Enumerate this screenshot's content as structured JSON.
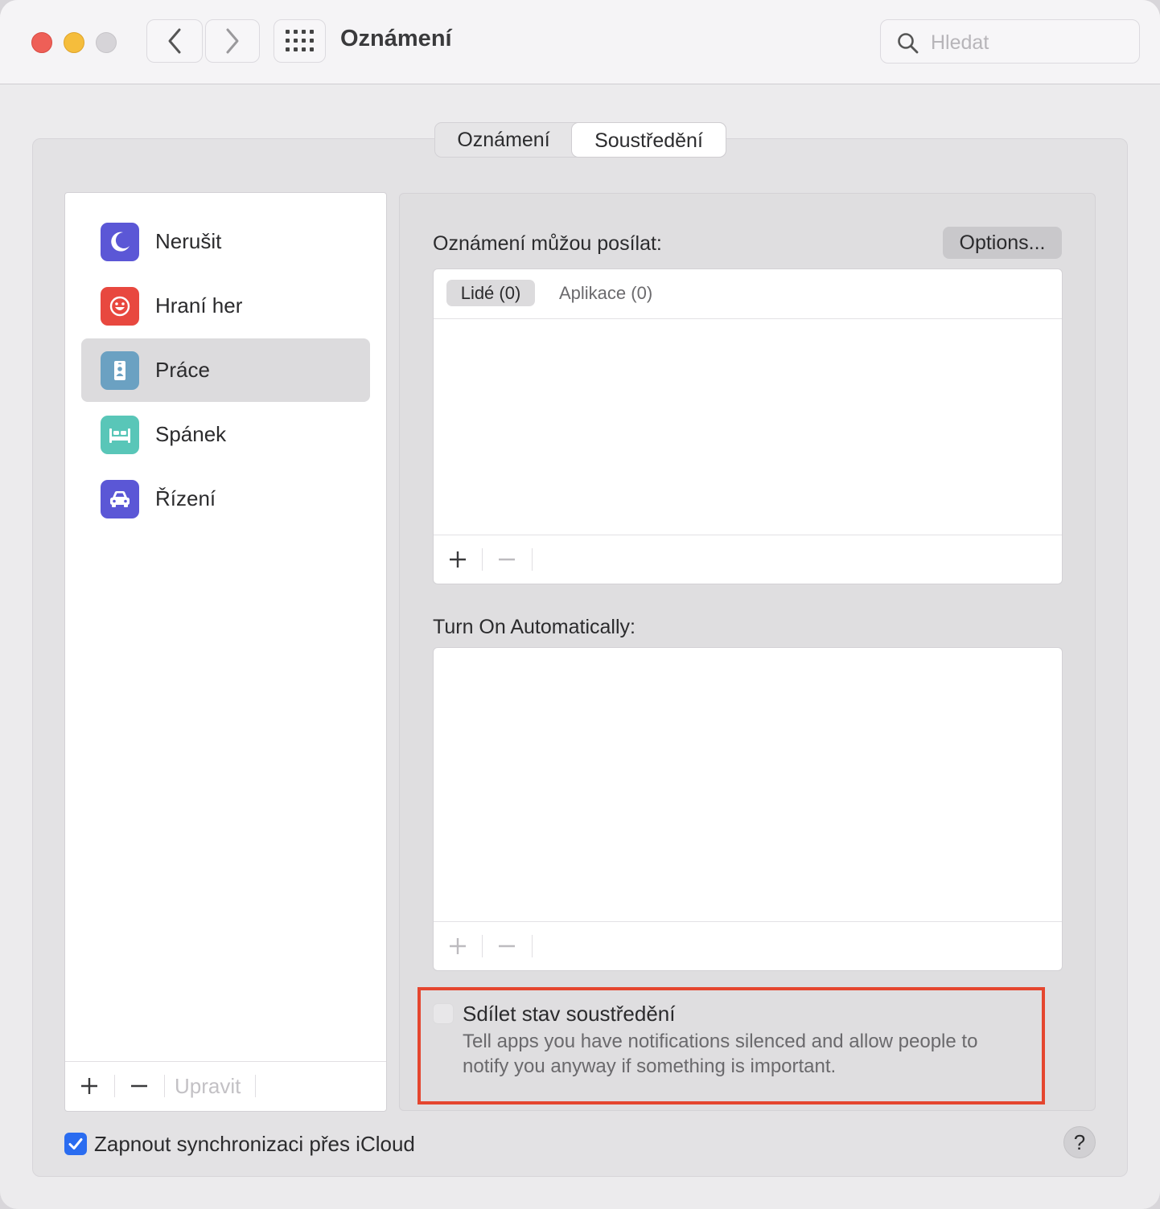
{
  "window": {
    "title": "Oznámení",
    "search_placeholder": "Hledat"
  },
  "tabs": [
    {
      "label": "Oznámení",
      "active": false
    },
    {
      "label": "Soustředění",
      "active": true
    }
  ],
  "focus_modes": [
    {
      "label": "Nerušit",
      "icon": "moon-icon",
      "color": "#5b57d6",
      "selected": false
    },
    {
      "label": "Hraní her",
      "icon": "game-smiley-icon",
      "color": "#e8483f",
      "selected": false
    },
    {
      "label": "Práce",
      "icon": "id-badge-icon",
      "color": "#6ba1c2",
      "selected": true
    },
    {
      "label": "Spánek",
      "icon": "bed-icon",
      "color": "#59c6b8",
      "selected": false
    },
    {
      "label": "Řízení",
      "icon": "car-icon",
      "color": "#5b57d6",
      "selected": false
    }
  ],
  "list_footer": {
    "add_label": "+",
    "remove_label": "−",
    "edit_label": "Upravit"
  },
  "allowed": {
    "label": "Oznámení můžou posílat:",
    "options_label": "Options...",
    "tab_people": "Lidé (0)",
    "tab_apps": "Aplikace (0)"
  },
  "automatic": {
    "label": "Turn On Automatically:"
  },
  "share_focus": {
    "checked": false,
    "title": "Sdílet stav soustředění",
    "description": "Tell apps you have notifications silenced and allow people to notify you anyway if something is important."
  },
  "icloud_sync": {
    "checked": true,
    "label": "Zapnout synchronizaci přes iCloud"
  },
  "help_label": "?",
  "colors": {
    "accent": "#2a6cf0",
    "highlight_border": "#e5462f"
  }
}
